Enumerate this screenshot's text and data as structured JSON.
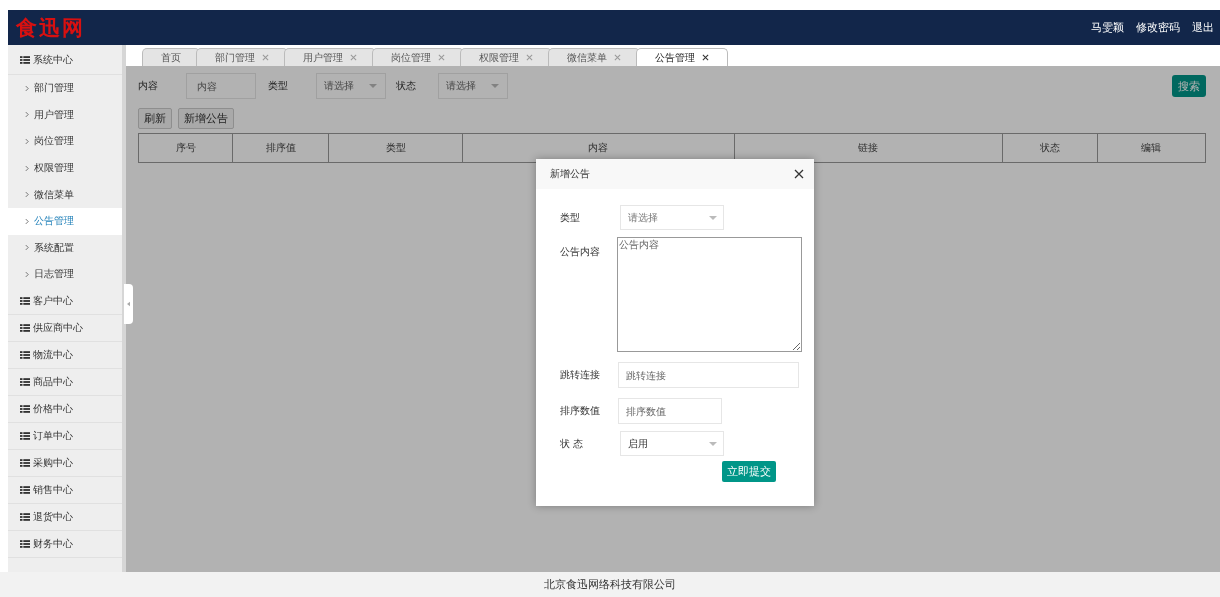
{
  "header": {
    "logo": "食迅网",
    "links": [
      "马雯颖",
      "修改密码",
      "退出"
    ]
  },
  "sidebar": {
    "groups": [
      {
        "label": "系统中心",
        "children": [
          {
            "label": "部门管理",
            "selected": false
          },
          {
            "label": "用户管理",
            "selected": false
          },
          {
            "label": "岗位管理",
            "selected": false
          },
          {
            "label": "权限管理",
            "selected": false
          },
          {
            "label": "微信菜单",
            "selected": false
          },
          {
            "label": "公告管理",
            "selected": true
          },
          {
            "label": "系统配置",
            "selected": false
          },
          {
            "label": "日志管理",
            "selected": false
          }
        ]
      },
      {
        "label": "客户中心"
      },
      {
        "label": "供应商中心"
      },
      {
        "label": "物流中心"
      },
      {
        "label": "商品中心"
      },
      {
        "label": "价格中心"
      },
      {
        "label": "订单中心"
      },
      {
        "label": "采购中心"
      },
      {
        "label": "销售中心"
      },
      {
        "label": "退货中心"
      },
      {
        "label": "财务中心"
      }
    ]
  },
  "tabs": [
    {
      "label": "首页",
      "closable": false,
      "selected": false
    },
    {
      "label": "部门管理",
      "closable": true,
      "selected": false
    },
    {
      "label": "用户管理",
      "closable": true,
      "selected": false
    },
    {
      "label": "岗位管理",
      "closable": true,
      "selected": false
    },
    {
      "label": "权限管理",
      "closable": true,
      "selected": false
    },
    {
      "label": "微信菜单",
      "closable": true,
      "selected": false
    },
    {
      "label": "公告管理",
      "closable": true,
      "selected": true
    }
  ],
  "filters": [
    {
      "kind": "input",
      "label": "内容",
      "placeholder": "内容"
    },
    {
      "kind": "select",
      "label": "类型",
      "placeholder": "请选择"
    },
    {
      "kind": "select",
      "label": "状态",
      "placeholder": "请选择"
    }
  ],
  "search_button": "搜索",
  "toolbar": [
    "刷新",
    "新增公告"
  ],
  "table": {
    "columns": [
      "序号",
      "排序值",
      "类型",
      "内容",
      "链接",
      "状态",
      "编辑"
    ]
  },
  "dialog": {
    "title": "新增公告",
    "fields": [
      {
        "kind": "select",
        "label": "类型",
        "placeholder": "请选择"
      },
      {
        "kind": "textarea",
        "label": "公告内容",
        "placeholder": "公告内容"
      },
      {
        "kind": "input",
        "label": "跳转连接",
        "placeholder": "跳转连接"
      },
      {
        "kind": "input",
        "label": "排序数值",
        "placeholder": "排序数值"
      },
      {
        "kind": "select",
        "label": "状 态",
        "value": "启用"
      }
    ],
    "submit": "立即提交"
  },
  "footer": "北京食迅网络科技有限公司"
}
